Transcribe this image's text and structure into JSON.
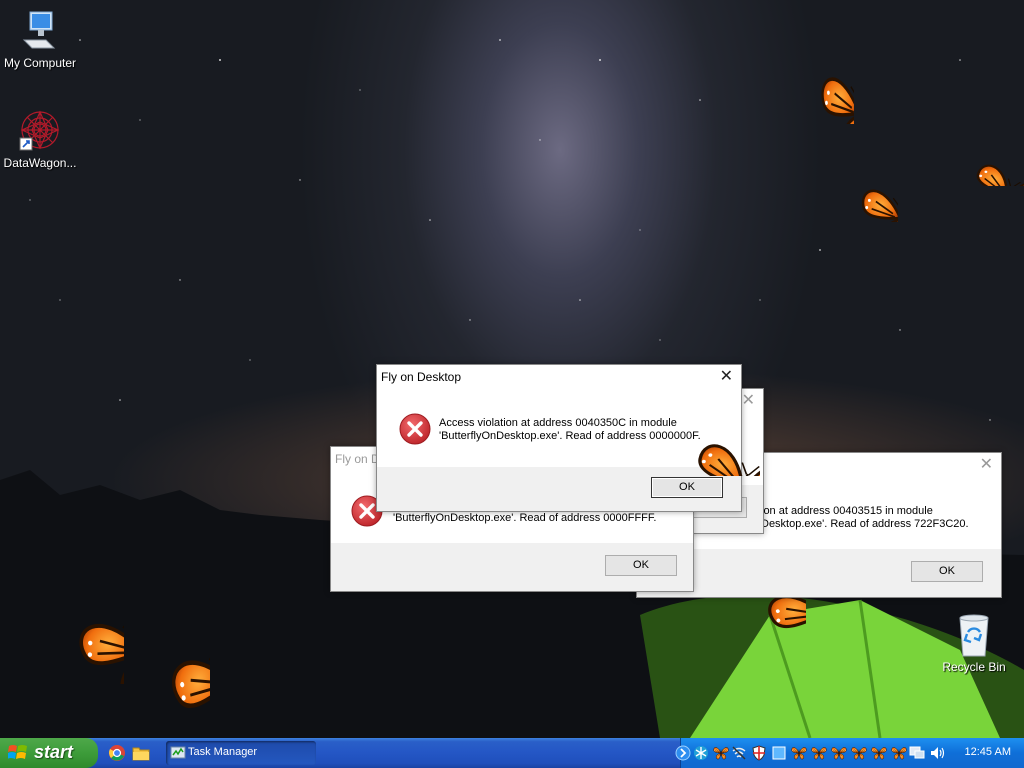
{
  "desktop": {
    "icons": [
      {
        "label": "My Computer"
      },
      {
        "label": "DataWagon..."
      },
      {
        "label": "Recycle Bin"
      }
    ]
  },
  "dialogs": [
    {
      "title": "Fly on Desktop",
      "line1": "Access violation at address 0040350C in module",
      "line2": "'ButterflyOnDesktop.exe'. Read of address 0000000F.",
      "ok_label": "OK"
    },
    {
      "title": "Fly on Desktop",
      "line1": "",
      "line2": "'ButterflyOnDesktop.exe'. Read of address 0000FFFF.",
      "ok_label": "OK"
    },
    {
      "title": "",
      "line1": "ion at address 00403515 in module",
      "line2": "Desktop.exe'. Read of address 722F3C20.",
      "ok_label": "OK"
    },
    {
      "title": "",
      "ok_label": "OK"
    }
  ],
  "taskbar": {
    "start_label": "start",
    "task_manager_label": "Task Manager",
    "clock": "12:45 AM"
  },
  "colors": {
    "taskbar_blue": "#245edb",
    "start_green": "#3d9c3a",
    "tray_blue": "#0f6fd8",
    "butterfly_orange": "#f07a12",
    "error_red": "#d9373b"
  },
  "icons": {
    "my_computer": "monitor-icon",
    "datawagon": "spiral-shortcut-icon",
    "recycle_bin": "recycle-bin-icon",
    "dialog_error": "error-x-icon",
    "start": "windows-flag-icon"
  }
}
